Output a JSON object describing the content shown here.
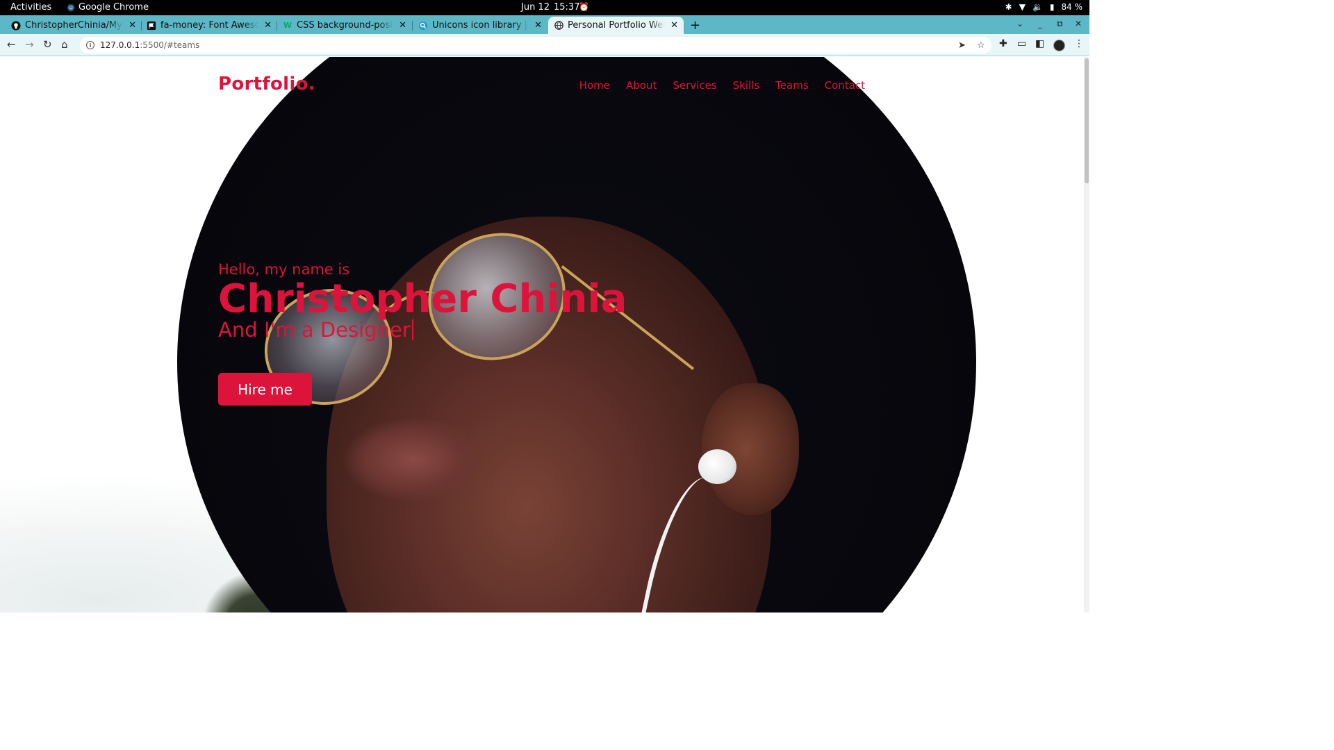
{
  "system_bar": {
    "activities": "Activities",
    "app_name": "Google Chrome",
    "date": "Jun 12",
    "time": "15:37",
    "battery": "84 %"
  },
  "browser": {
    "tabs": [
      {
        "title": "ChristopherChinia/My-Po",
        "favicon": "github-icon"
      },
      {
        "title": "fa-money: Font Awesome",
        "favicon": "font-awesome-flag-icon"
      },
      {
        "title": "CSS background-position",
        "favicon": "w3schools-icon"
      },
      {
        "title": "Unicons icon library | Line",
        "favicon": "unicons-icon"
      },
      {
        "title": "Personal Portfolio Websit",
        "favicon": "globe-icon",
        "active": true
      }
    ],
    "url_host": "127.0.0.1",
    "url_rest": ":5500/#teams"
  },
  "page": {
    "logo": "Portfolio.",
    "nav": [
      "Home",
      "About",
      "Services",
      "Skills",
      "Teams",
      "Contact"
    ],
    "hero": {
      "greeting": "Hello, my name is",
      "name": "Christopher Chinia",
      "role": "And I'm a Designer"
    },
    "cta": "Hire me"
  },
  "colors": {
    "accent": "#dc143c",
    "tabstrip": "#5cb8c6",
    "toolbar": "#e8f6f8"
  }
}
